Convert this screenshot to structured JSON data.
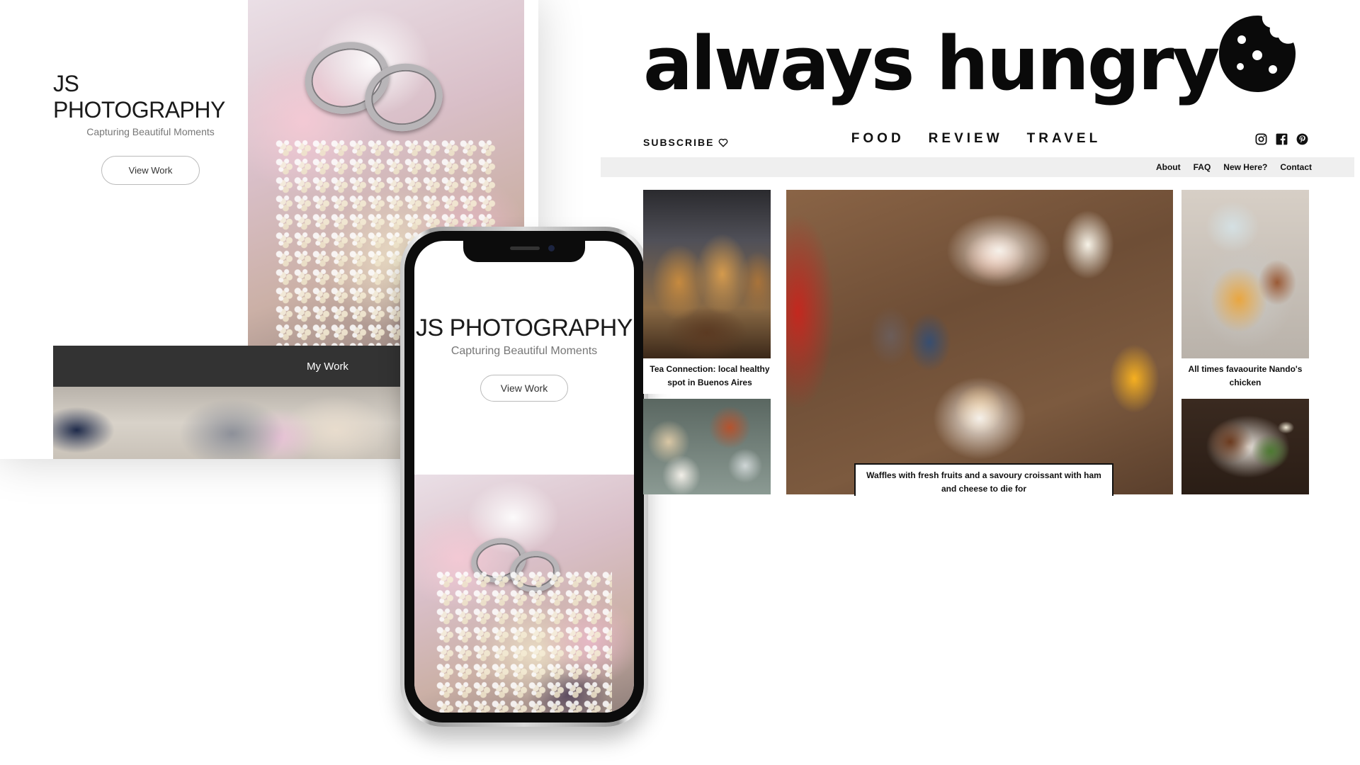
{
  "desktop_site": {
    "brand_title": "JS PHOTOGRAPHY",
    "brand_subtitle": "Capturing Beautiful Moments",
    "view_button": "View Work",
    "section_label": "My Work"
  },
  "phone_site": {
    "brand_title": "JS PHOTOGRAPHY",
    "brand_subtitle": "Capturing Beautiful Moments",
    "view_button": "View Work"
  },
  "blog": {
    "logo_text": "always hungry",
    "logo_icon": "cookie-icon",
    "subscribe_label": "SUBSCRIBE",
    "subscribe_icon": "heart-icon",
    "main_nav": [
      "FOOD",
      "REVIEW",
      "TRAVEL"
    ],
    "social_icons": [
      "instagram-icon",
      "facebook-icon",
      "pinterest-icon"
    ],
    "sub_nav": [
      "About",
      "FAQ",
      "New Here?",
      "Contact"
    ],
    "posts": [
      {
        "caption": "Tea Connection: local healthy spot in Buenos Aires"
      },
      {
        "caption": "Waffles with fresh fruits and a savoury croissant with ham and cheese to die for"
      },
      {
        "caption": "All times favaourite Nando's chicken"
      }
    ]
  },
  "colors": {
    "dark_bar": "#333333",
    "sub_nav_bg": "#efefef",
    "text_primary": "#111111",
    "text_muted": "#777777"
  }
}
